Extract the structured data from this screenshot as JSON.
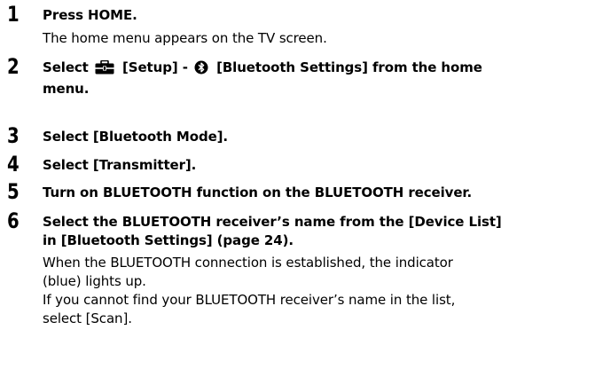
{
  "steps": [
    {
      "number": "1",
      "title": "Press HOME.",
      "body": [
        "The home menu appears on the TV screen."
      ]
    },
    {
      "number": "2",
      "title_prefix": "Select",
      "title_setup": "[Setup] -",
      "title_bt": "[Bluetooth Settings] from the home",
      "title_line2": "menu.",
      "icons": [
        "toolbox-icon",
        "bluetooth-icon"
      ]
    },
    {
      "number": "3",
      "title": "Select [Bluetooth Mode]."
    },
    {
      "number": "4",
      "title": "Select [Transmitter]."
    },
    {
      "number": "5",
      "title": "Turn on BLUETOOTH function on the BLUETOOTH receiver."
    },
    {
      "number": "6",
      "title_lines": [
        "Select the BLUETOOTH receiver’s name from the [Device List]",
        "in [Bluetooth Settings] (page 24)."
      ],
      "body": [
        "When the BLUETOOTH connection is established, the indicator",
        "(blue) lights up.",
        "If you cannot find your BLUETOOTH receiver’s name in the list,",
        "select [Scan]."
      ]
    }
  ]
}
